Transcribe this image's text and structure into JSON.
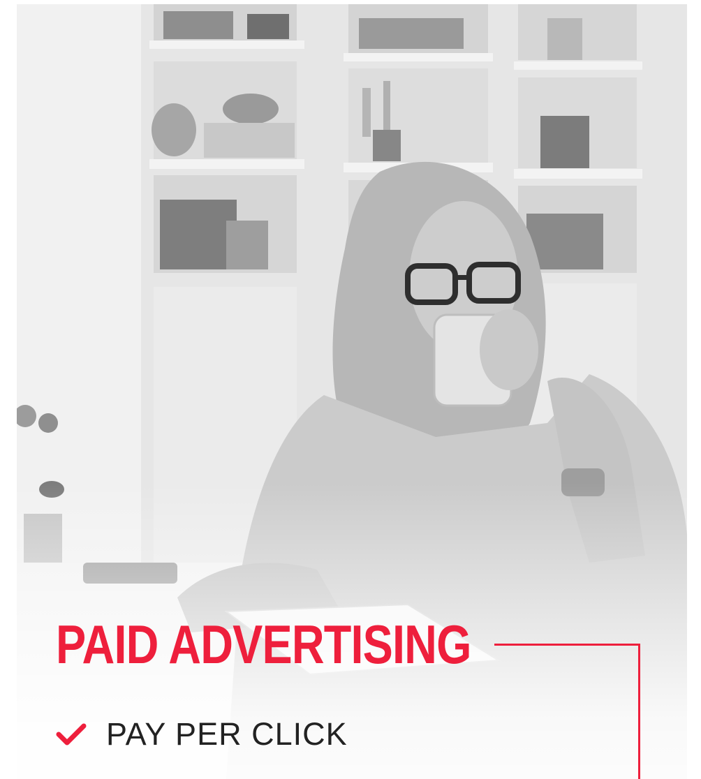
{
  "hero": {
    "headline": "PAID ADVERTISING",
    "feature_label": "PAY PER CLICK",
    "feature_icon": "check-icon",
    "photo_icon": "photo-woman-drinking-water"
  },
  "colors": {
    "accent": "#ee1f3c",
    "text": "#222222",
    "background": "#ffffff"
  }
}
